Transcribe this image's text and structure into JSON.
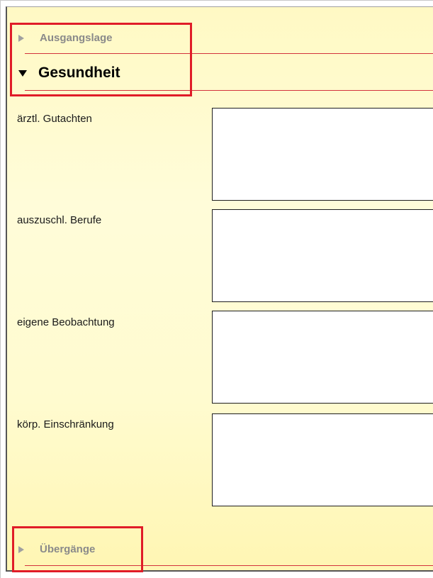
{
  "sections": {
    "ausgangslage": {
      "label": "Ausgangslage",
      "expanded": false
    },
    "gesundheit": {
      "label": "Gesundheit",
      "expanded": true
    },
    "uebergaenge": {
      "label": "Übergänge",
      "expanded": false
    }
  },
  "fields": [
    {
      "label": "ärztl. Gutachten",
      "value": ""
    },
    {
      "label": "auszuschl. Berufe",
      "value": ""
    },
    {
      "label": "eigene Beobachtung",
      "value": ""
    },
    {
      "label": "körp. Einschränkung",
      "value": ""
    }
  ],
  "colors": {
    "highlight_border": "#e01c28",
    "section_rule": "#d2323c",
    "panel_background": "#fffbcf"
  },
  "icons": {
    "collapsed": "triangle-right-icon",
    "expanded": "triangle-down-icon"
  }
}
